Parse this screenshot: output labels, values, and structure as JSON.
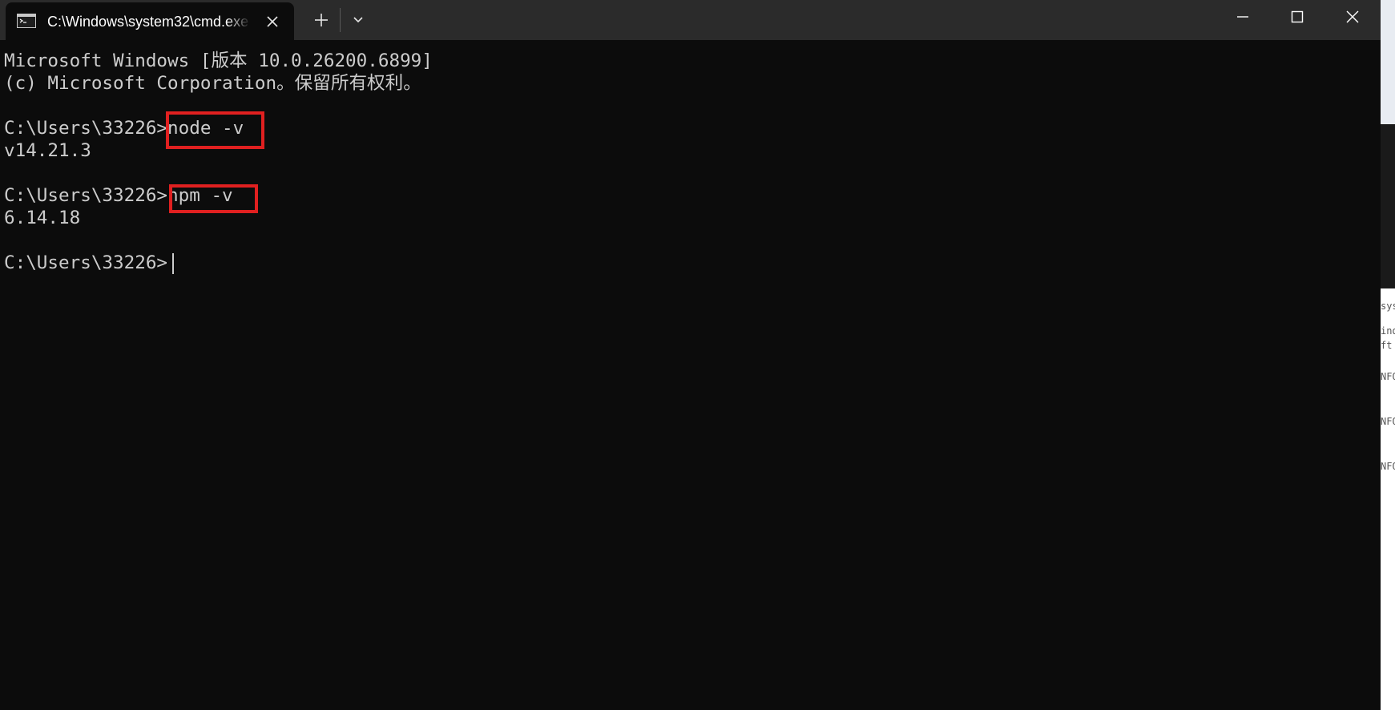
{
  "window": {
    "tab_title": "C:\\Windows\\system32\\cmd.exe",
    "icons": {
      "tab": "cmd-icon",
      "close_tab": "close-icon",
      "new_tab": "plus-icon",
      "dropdown": "chevron-down-icon",
      "minimize": "minimize-icon",
      "maximize": "maximize-icon",
      "close_window": "close-icon"
    },
    "colors": {
      "titlebar": "#2b2b2b",
      "background": "#0c0c0c",
      "text": "#cccccc",
      "highlight_box": "#e02020"
    }
  },
  "terminal": {
    "lines": [
      "Microsoft Windows [版本 10.0.26200.6899]",
      "(c) Microsoft Corporation。保留所有权利。",
      "",
      "C:\\Users\\33226>node -v",
      "v14.21.3",
      "",
      "C:\\Users\\33226>npm -v",
      "6.14.18",
      "",
      "C:\\Users\\33226>"
    ],
    "prompt": "C:\\Users\\33226>",
    "commands": [
      "node -v",
      "npm -v"
    ],
    "outputs": [
      "v14.21.3",
      "6.14.18"
    ]
  },
  "background_window": {
    "fragments": [
      "sys",
      "ind",
      "ft",
      "NFO",
      "NFO",
      "NFO"
    ]
  }
}
